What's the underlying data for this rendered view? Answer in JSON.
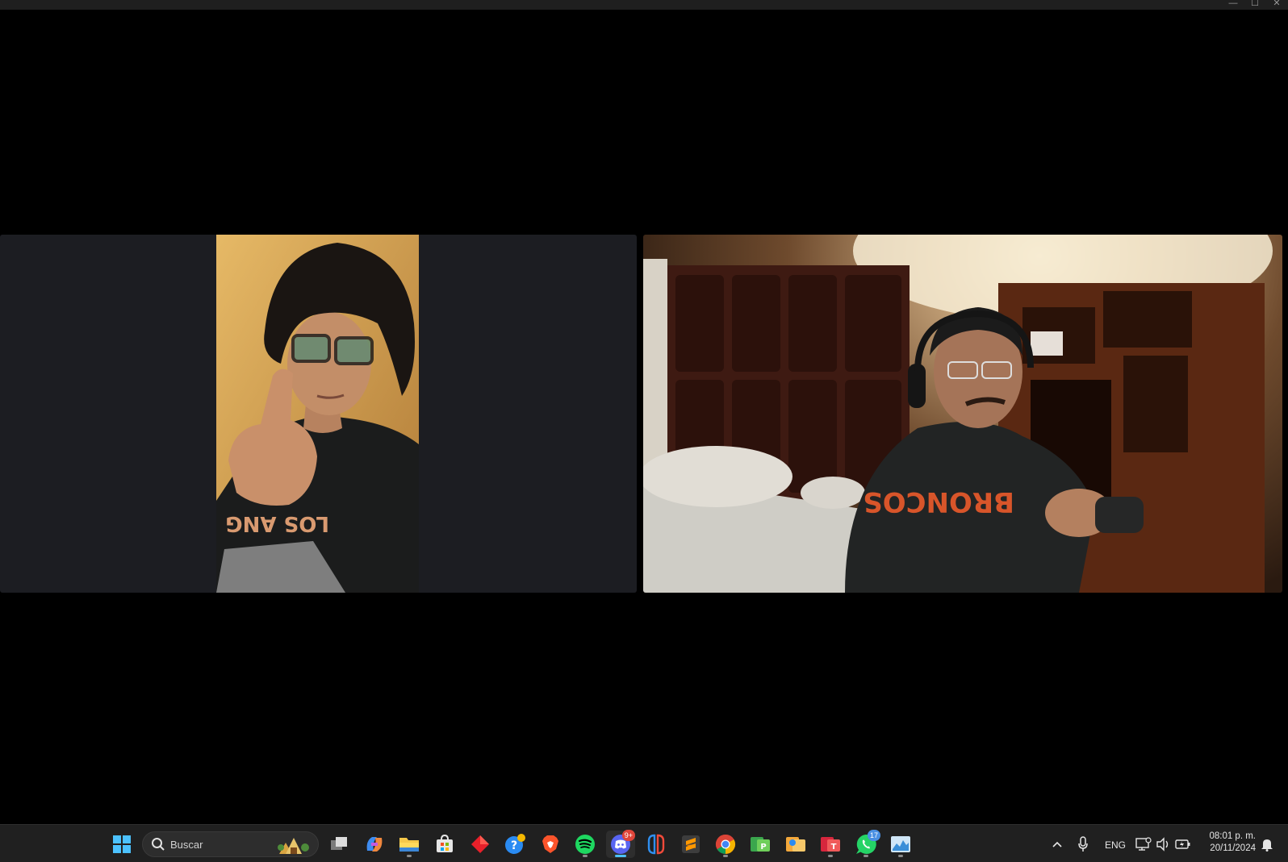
{
  "window": {
    "minimize_glyph": "—",
    "maximize_glyph": "☐",
    "close_glyph": "✕"
  },
  "participants": [
    {
      "name": "",
      "video": "portrait"
    },
    {
      "name": "",
      "video": "landscape"
    }
  ],
  "taskbar": {
    "search_placeholder": "Buscar",
    "apps": [
      {
        "id": "start",
        "icon": "windows-start-icon"
      },
      {
        "id": "task-view",
        "icon": "task-view-icon"
      },
      {
        "id": "copilot",
        "icon": "copilot-icon"
      },
      {
        "id": "file-explorer",
        "icon": "folder-icon",
        "running": true
      },
      {
        "id": "store",
        "icon": "store-icon"
      },
      {
        "id": "app-red-diamond",
        "icon": "red-diamond-icon"
      },
      {
        "id": "get-help",
        "icon": "help-icon"
      },
      {
        "id": "brave",
        "icon": "brave-icon"
      },
      {
        "id": "spotify",
        "icon": "spotify-icon",
        "running": true
      },
      {
        "id": "discord",
        "icon": "discord-icon",
        "running": true,
        "active": true,
        "badge": "9+"
      },
      {
        "id": "game-app",
        "icon": "switch-controller-icon"
      },
      {
        "id": "sublime",
        "icon": "sublime-icon"
      },
      {
        "id": "chrome",
        "icon": "chrome-icon",
        "running": true
      },
      {
        "id": "green-app",
        "icon": "green-project-icon"
      },
      {
        "id": "orange-app",
        "icon": "orange-app-icon"
      },
      {
        "id": "red-app",
        "icon": "red-app-icon",
        "running": true
      },
      {
        "id": "whatsapp",
        "icon": "whatsapp-icon",
        "running": true,
        "badge": "17"
      },
      {
        "id": "task-manager",
        "icon": "task-manager-icon",
        "running": true
      }
    ],
    "tray": {
      "language": "ENG",
      "time": "08:01 p. m.",
      "date": "20/11/2024"
    }
  },
  "colors": {
    "taskbar_bg": "#202020",
    "accent": "#4cc2ff",
    "tile_bg": "#1c1d22"
  }
}
